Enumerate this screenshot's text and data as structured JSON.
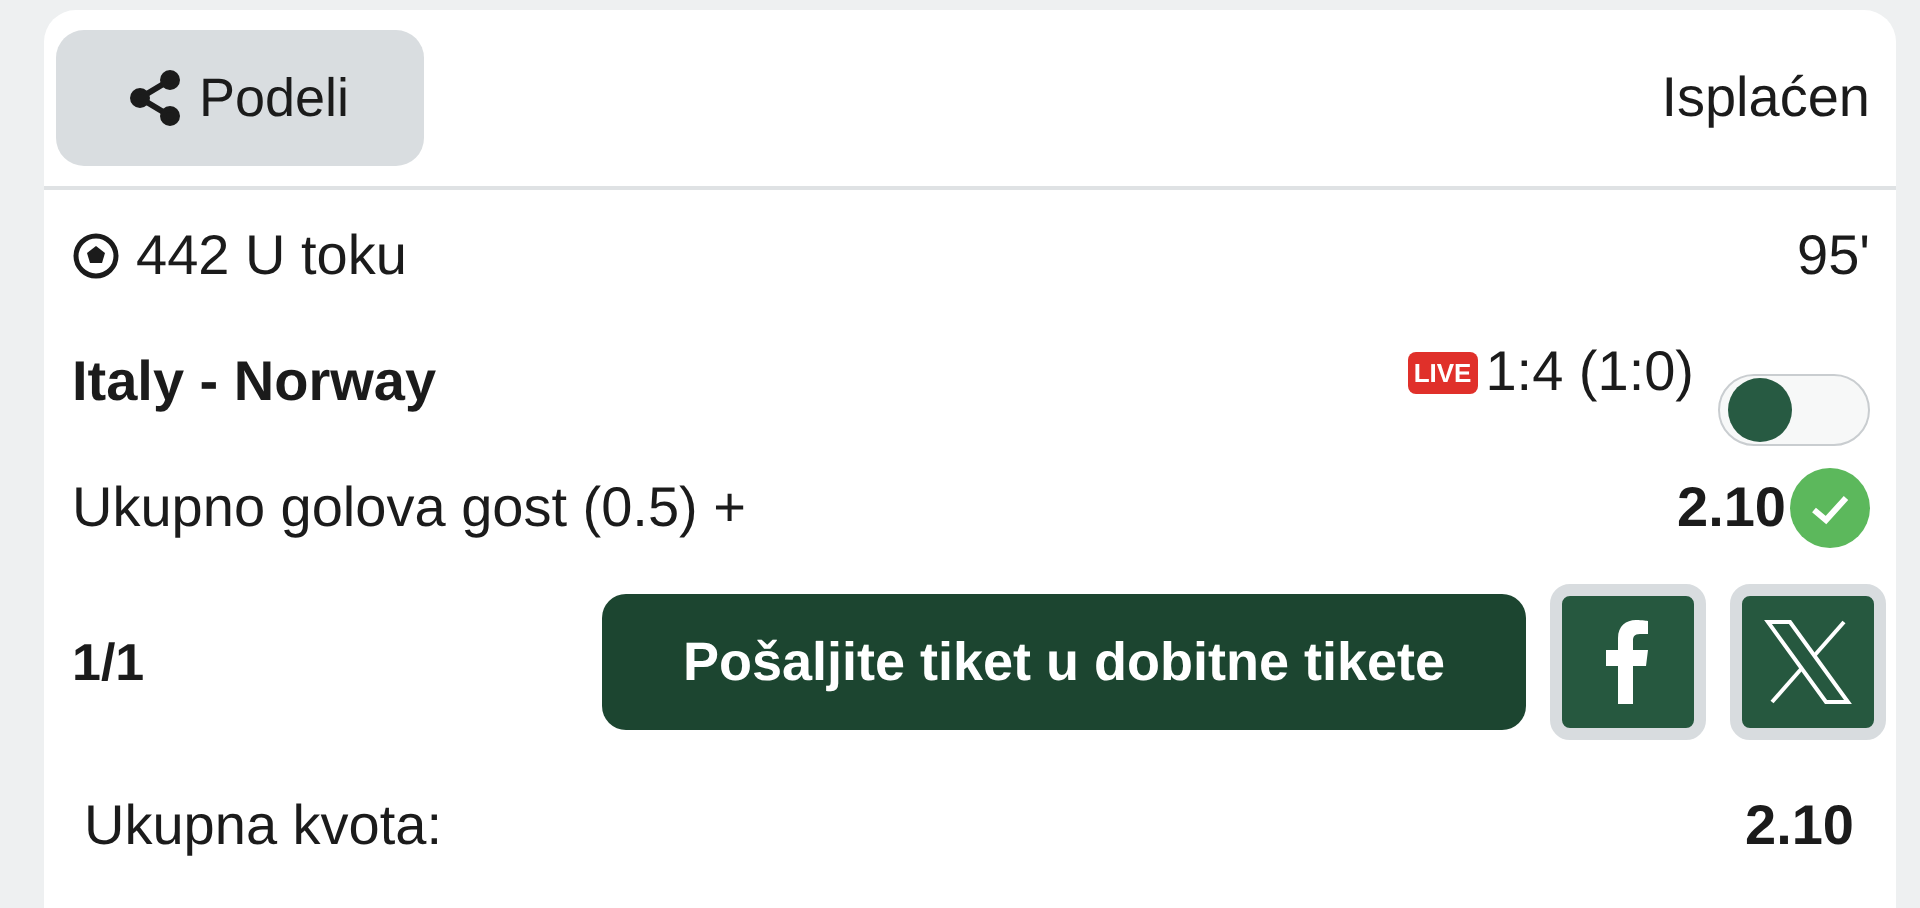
{
  "header": {
    "share_button": "Podeli",
    "status": "Isplaćen"
  },
  "event": {
    "code": "442 U toku",
    "minute": "95'",
    "teams": "Italy - Norway",
    "live_badge": "LIVE",
    "score": "1:4 (1:0)",
    "toggle_on": false
  },
  "bet": {
    "market": "Ukupno golova gost (0.5) +",
    "odds": "2.10",
    "won": true
  },
  "actions": {
    "count": "1/1",
    "send_button": "Pošaljite tiket u dobitne tikete"
  },
  "total": {
    "label": "Ukupna kvota:",
    "value": "2.10"
  }
}
